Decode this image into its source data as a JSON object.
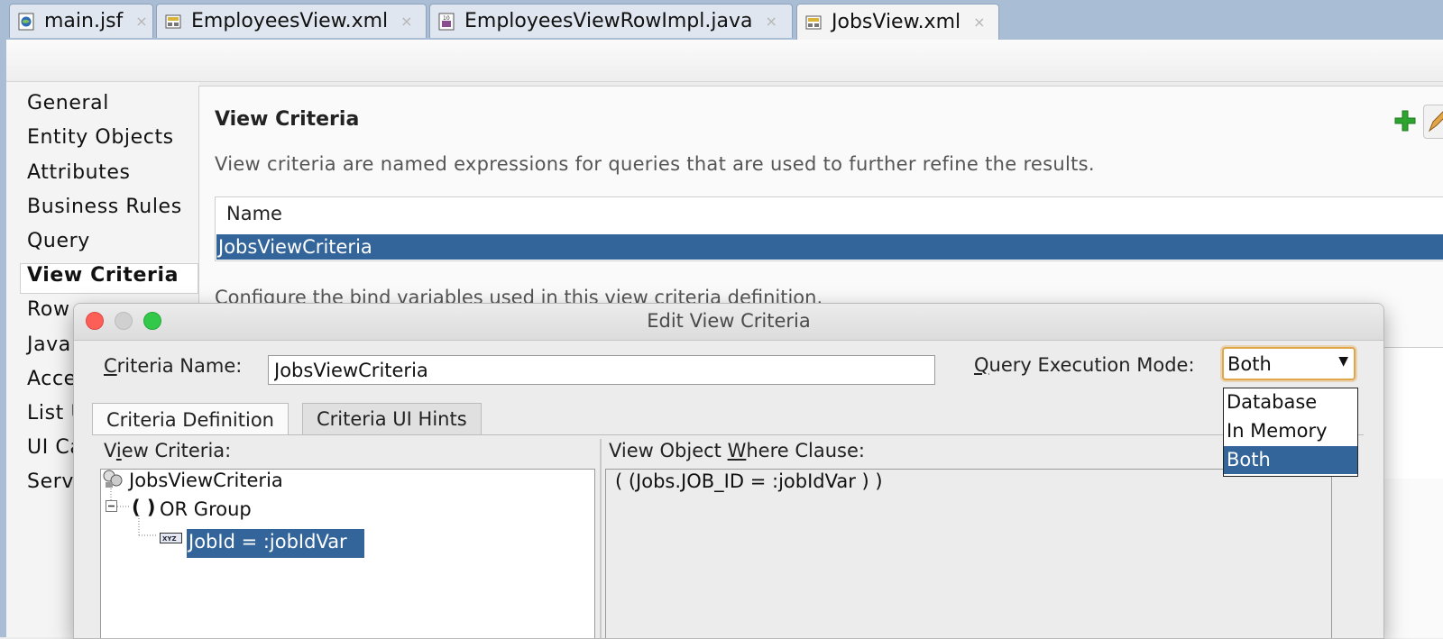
{
  "editor_tabs": [
    {
      "label": "main.jsf",
      "icon": "globe-page-icon"
    },
    {
      "label": "EmployeesView.xml",
      "icon": "view-object-icon"
    },
    {
      "label": "EmployeesViewRowImpl.java",
      "icon": "java-class-icon"
    },
    {
      "label": "JobsView.xml",
      "icon": "view-object-icon",
      "active": true
    }
  ],
  "close_glyph": "×",
  "nav": {
    "items": [
      "General",
      "Entity Objects",
      "Attributes",
      "Business Rules",
      "Query",
      "View Criteria",
      "Row",
      "Java",
      "Acce",
      "List U",
      "UI Ca",
      "Servi"
    ],
    "selected": "View Criteria"
  },
  "view_criteria": {
    "title": "View Criteria",
    "description": "View criteria are named expressions for queries that are used to further refine the results.",
    "table_header": "Name",
    "rows": [
      "JobsViewCriteria"
    ],
    "bind_description": "Configure the bind variables used in this view criteria definition."
  },
  "dialog": {
    "title": "Edit View Criteria",
    "criteria_name_label_key": "C",
    "criteria_name_label_rest": "riteria Name:",
    "criteria_name_value": "JobsViewCriteria",
    "mode_label_key": "Q",
    "mode_label_rest": "uery Execution Mode:",
    "mode_selected": "Both",
    "mode_options": [
      "Database",
      "In Memory",
      "Both"
    ],
    "tabs": [
      "Criteria Definition",
      "Criteria UI Hints"
    ],
    "view_criteria_label_pre": "V",
    "view_criteria_label_key": "i",
    "view_criteria_label_rest": "ew Criteria:",
    "where_label_pre": "View Object ",
    "where_label_key": "W",
    "where_label_rest": "here Clause:",
    "tree": {
      "root": "JobsViewCriteria",
      "group_paren": "( )",
      "group": "OR Group",
      "item": "JobId = :jobIdVar"
    },
    "where_clause": "( (Jobs.JOB_ID = :jobIdVar ) )"
  },
  "colors": {
    "selection": "#33659a",
    "tab_strip": "#a9bdd5",
    "focus_ring": "#e1a64a",
    "add_green": "#2fa32f"
  }
}
